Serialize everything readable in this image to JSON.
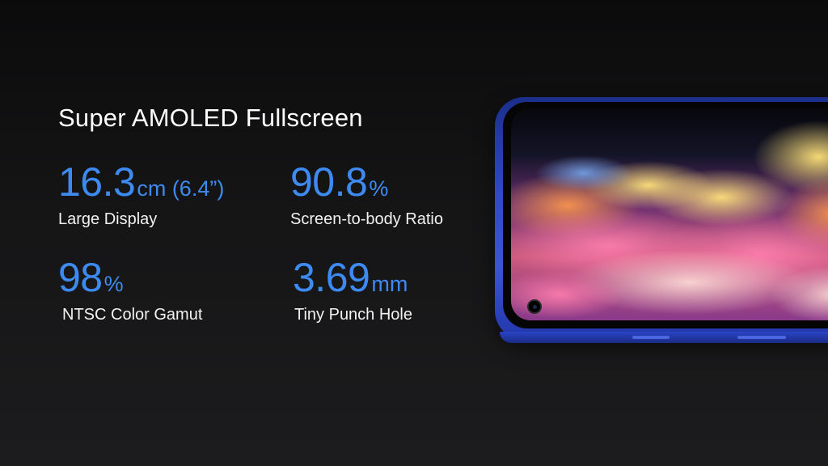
{
  "title": "Super AMOLED Fullscreen",
  "stats": [
    {
      "value": "16.3",
      "unit": "cm (6.4”)",
      "label": "Large Display"
    },
    {
      "value": "90.8",
      "unit": "%",
      "label": "Screen-to-body Ratio"
    },
    {
      "value": "98",
      "unit": "%",
      "label": "NTSC Color Gamut"
    },
    {
      "value": "3.69",
      "unit": "mm",
      "label": "Tiny Punch Hole"
    }
  ],
  "colors": {
    "accent": "#3d8bf2",
    "background": "#151516",
    "phone_body": "#2f49c8"
  }
}
